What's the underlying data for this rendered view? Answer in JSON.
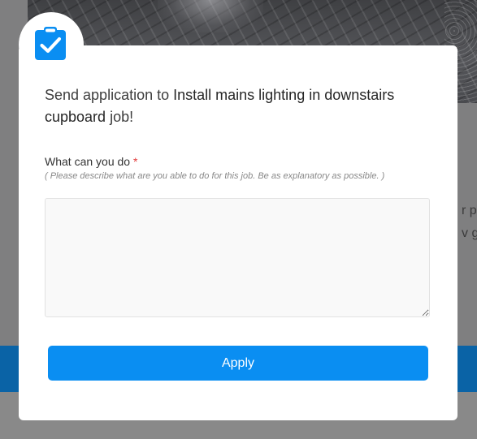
{
  "background": {
    "text_line_1": "r pr",
    "text_line_2": "v go"
  },
  "modal": {
    "icon": "clipboard-check-icon",
    "title_prefix": "Send application to ",
    "job_name": "Install mains lighting in downstairs cupboard",
    "title_suffix": " job!",
    "field_label": "What can you do",
    "required_marker": "*",
    "field_hint": "( Please describe what are you able to do for this job. Be as explanatory as possible. )",
    "textarea_value": "",
    "apply_label": "Apply",
    "colors": {
      "accent": "#0a8ef2",
      "required": "#e23b3b",
      "band": "#0a63a6"
    }
  }
}
